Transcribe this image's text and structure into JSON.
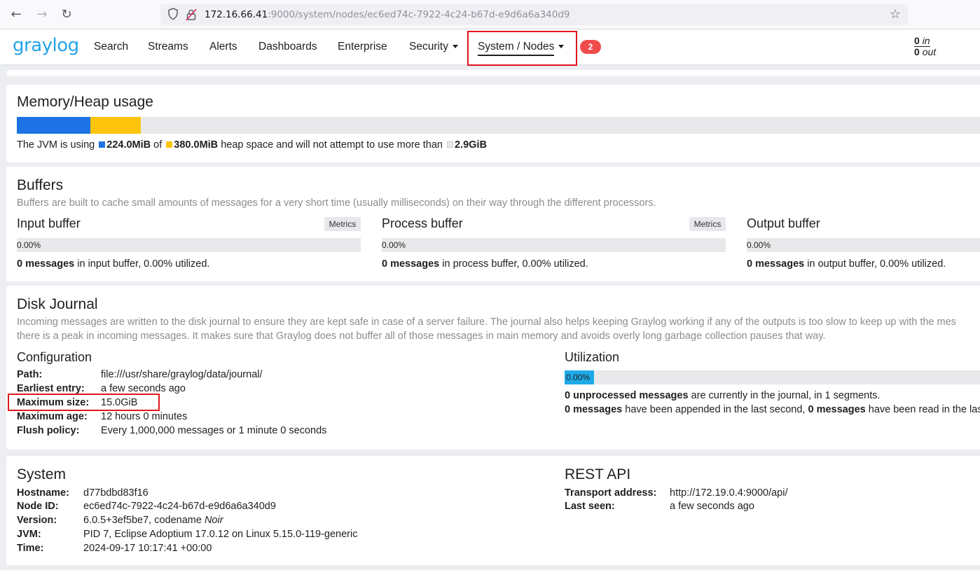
{
  "browser": {
    "back": "←",
    "forward": "→",
    "reload": "↻",
    "url_host": "172.16.66.41",
    "url_rest": ":9000/system/nodes/ec6ed74c-7922-4c24-b67d-e9d6a6a340d9",
    "star": "☆"
  },
  "nav": {
    "logo": "graylog",
    "items": [
      "Search",
      "Streams",
      "Alerts",
      "Dashboards",
      "Enterprise",
      "Security"
    ],
    "active": "System / Nodes",
    "notification_count": "2",
    "throughput_in_num": "0",
    "throughput_in_label": "in",
    "throughput_out_num": "0",
    "throughput_out_label": "out"
  },
  "memory": {
    "title": "Memory/Heap usage",
    "prefix": "The JVM is using",
    "used": "224.0MiB",
    "of": "of",
    "committed": "380.0MiB",
    "middle": "heap space and will not attempt to use more than",
    "max": "2.9GiB",
    "used_fraction": 0.0755,
    "committed_fraction": 0.128,
    "colors": {
      "used": "#1d73e5",
      "committed": "#fdc40e",
      "max": "#e9e9ec"
    }
  },
  "buffers": {
    "title": "Buffers",
    "description": "Buffers are built to cache small amounts of messages for a very short time (usually milliseconds) on their way through the different processors.",
    "metrics_label": "Metrics",
    "input": {
      "title": "Input buffer",
      "percent": "0.00%",
      "count": "0 messages",
      "rest": "in input buffer, 0.00% utilized."
    },
    "process": {
      "title": "Process buffer",
      "percent": "0.00%",
      "count": "0 messages",
      "rest": "in process buffer, 0.00% utilized."
    },
    "output": {
      "title": "Output buffer",
      "percent": "0.00%",
      "count": "0 messages",
      "rest": "in output buffer, 0.00% utilized."
    }
  },
  "journal": {
    "title": "Disk Journal",
    "description_1": "Incoming messages are written to the disk journal to ensure they are kept safe in case of a server failure. The journal also helps keeping Graylog working if any of the outputs is too slow to keep up with the mes",
    "description_2": "there is a peak in incoming messages. It makes sure that Graylog does not buffer all of those messages in main memory and avoids overly long garbage collection pauses that way.",
    "config_title": "Configuration",
    "config": [
      {
        "key": "Path:",
        "value": "file:///usr/share/graylog/data/journal/"
      },
      {
        "key": "Earliest entry:",
        "value": "a few seconds ago"
      },
      {
        "key": "Maximum size:",
        "value": "15.0GiB"
      },
      {
        "key": "Maximum age:",
        "value": "12 hours 0 minutes"
      },
      {
        "key": "Flush policy:",
        "value": "Every 1,000,000 messages or 1 minute 0 seconds"
      }
    ],
    "util_title": "Utilization",
    "util_percent": "0.00%",
    "util_line1_bold": "0 unprocessed messages",
    "util_line1_rest": "are currently in the journal, in 1 segments.",
    "util_line2_bold1": "0 messages",
    "util_line2_mid": "have been appended in the last second,",
    "util_line2_bold2": "0 messages",
    "util_line2_rest": "have been read in the las"
  },
  "system": {
    "title": "System",
    "rows": [
      {
        "key": "Hostname:",
        "value": "d77bdbd83f16"
      },
      {
        "key": "Node ID:",
        "value": "ec6ed74c-7922-4c24-b67d-e9d6a6a340d9"
      },
      {
        "key": "Version:",
        "value": "6.0.5+3ef5be7, codename",
        "italic": "Noir"
      },
      {
        "key": "JVM:",
        "value": "PID 7, Eclipse Adoptium 17.0.12 on Linux 5.15.0-119-generic"
      },
      {
        "key": "Time:",
        "value": "2024-09-17 10:17:41 +00:00"
      }
    ]
  },
  "rest_api": {
    "title": "REST API",
    "rows": [
      {
        "key": "Transport address:",
        "value": "http://172.19.0.4:9000/api/"
      },
      {
        "key": "Last seen:",
        "value": "a few seconds ago"
      }
    ]
  }
}
